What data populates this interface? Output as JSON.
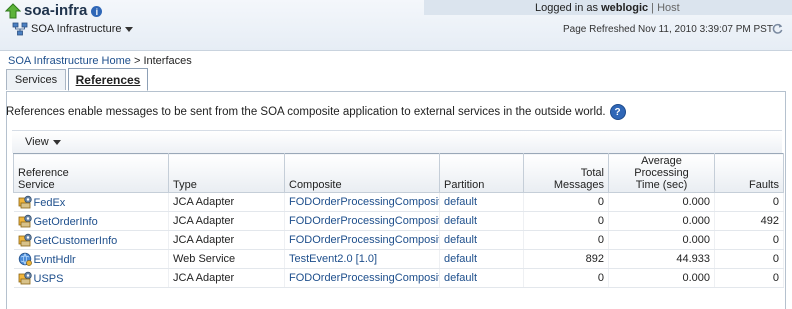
{
  "header": {
    "title": "soa-infra",
    "menu_label": "SOA Infrastructure",
    "logged_in_label": "Logged in as",
    "user": "weblogic",
    "host_label": "Host",
    "refreshed": "Page Refreshed Nov 11, 2010 3:39:07 PM PST"
  },
  "breadcrumb": {
    "home": "SOA Infrastructure Home",
    "separator": " > ",
    "current": "Interfaces"
  },
  "tabs": [
    {
      "label": "Services",
      "selected": false
    },
    {
      "label": "References",
      "selected": true
    }
  ],
  "description": "References enable messages to be sent from the SOA composite application to external services in the outside world.",
  "toolbar": {
    "view_label": "View"
  },
  "table": {
    "columns": {
      "reference_service_line1": "Reference",
      "reference_service_line2": "Service",
      "type": "Type",
      "composite": "Composite",
      "partition": "Partition",
      "total_line1": "Total",
      "total_line2": "Messages",
      "avg_line1": "Average Processing",
      "avg_line2": "Time (sec)",
      "faults": "Faults"
    },
    "rows": [
      {
        "name": "FedEx",
        "icon": "jca-adapter-icon",
        "type": "JCA Adapter",
        "composite": "FODOrderProcessingComposite",
        "partition": "default",
        "total": "0",
        "avg": "0.000",
        "faults": "0"
      },
      {
        "name": "GetOrderInfo",
        "icon": "jca-adapter-icon",
        "type": "JCA Adapter",
        "composite": "FODOrderProcessingComposite",
        "partition": "default",
        "total": "0",
        "avg": "0.000",
        "faults": "492"
      },
      {
        "name": "GetCustomerInfo",
        "icon": "jca-adapter-icon",
        "type": "JCA Adapter",
        "composite": "FODOrderProcessingComposite",
        "partition": "default",
        "total": "0",
        "avg": "0.000",
        "faults": "0"
      },
      {
        "name": "EvntHdlr",
        "icon": "web-service-icon",
        "type": "Web Service",
        "composite": "TestEvent2.0 [1.0]",
        "partition": "default",
        "total": "892",
        "avg": "44.933",
        "faults": "0"
      },
      {
        "name": "USPS",
        "icon": "jca-adapter-icon",
        "type": "JCA Adapter",
        "composite": "FODOrderProcessingComposite",
        "partition": "default",
        "total": "0",
        "avg": "0.000",
        "faults": "0"
      }
    ]
  }
}
